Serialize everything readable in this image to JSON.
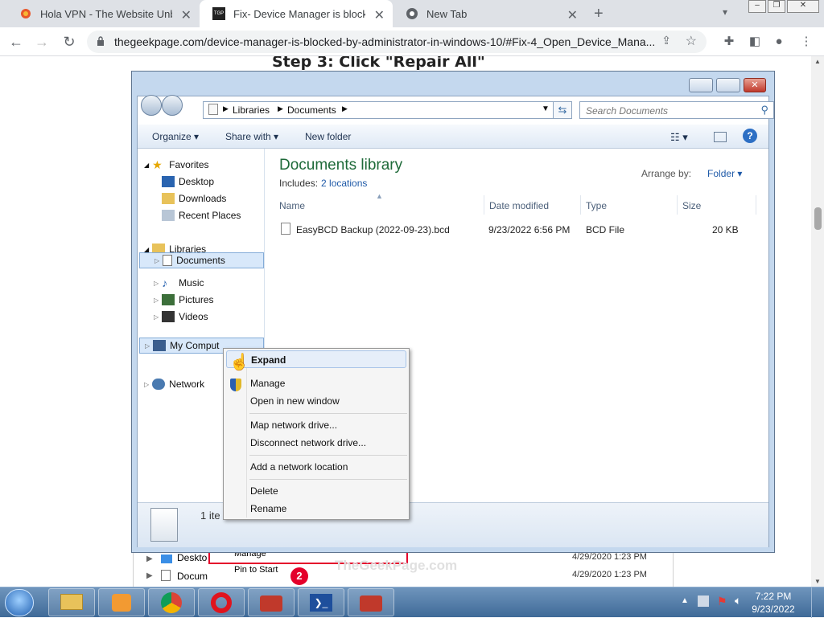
{
  "browser": {
    "tabs": [
      {
        "title": "Hola VPN - The Website Unblock",
        "icon": "hola-icon"
      },
      {
        "title": "Fix- Device Manager is blocked b",
        "icon": "tgp-icon",
        "icon_text": "TGP"
      },
      {
        "title": "New Tab",
        "icon": "chrome-icon"
      }
    ],
    "url": "thegeekpage.com/device-manager-is-blocked-by-administrator-in-windows-10/#Fix-4_Open_Device_Mana..."
  },
  "page": {
    "step_title": "Step 3: Click \"Repair All\""
  },
  "explorer": {
    "breadcrumb": [
      "Libraries",
      "Documents"
    ],
    "search_placeholder": "Search Documents",
    "commands": {
      "organize": "Organize",
      "share": "Share with",
      "new_folder": "New folder"
    },
    "nav": {
      "favorites": "Favorites",
      "desktop": "Desktop",
      "downloads": "Downloads",
      "recent": "Recent Places",
      "libraries": "Libraries",
      "documents": "Documents",
      "music": "Music",
      "pictures": "Pictures",
      "videos": "Videos",
      "computer": "My Comput",
      "network": "Network"
    },
    "library_title": "Documents library",
    "includes_label": "Includes:",
    "includes_link": "2 locations",
    "arrange_label": "Arrange by:",
    "arrange_value": "Folder",
    "columns": {
      "name": "Name",
      "date": "Date modified",
      "type": "Type",
      "size": "Size"
    },
    "files": [
      {
        "name": "EasyBCD Backup (2022-09-23).bcd",
        "date": "9/23/2022 6:56 PM",
        "type": "BCD File",
        "size": "20 KB"
      }
    ],
    "status_count": "1 ite"
  },
  "context_menu": {
    "items": [
      "Expand",
      "Manage",
      "Open in new window",
      "Map network drive...",
      "Disconnect network drive...",
      "Add a network location",
      "Delete",
      "Rename"
    ]
  },
  "background_window": {
    "rows": [
      {
        "name": "Deskto",
        "date": "4/29/2020 1:23 PM"
      },
      {
        "name": "Docum",
        "date": "4/29/2020 1:23 PM"
      }
    ],
    "menu_items": [
      "Manage",
      "Pin to Start"
    ],
    "badge": "2",
    "watermark": "TheGeekPage.com"
  },
  "taskbar": {
    "time": "7:22 PM",
    "date": "9/23/2022"
  },
  "colors": {
    "accent": "#1e6a39",
    "link": "#1f5aa8",
    "taskbar": "#4f78a4"
  }
}
